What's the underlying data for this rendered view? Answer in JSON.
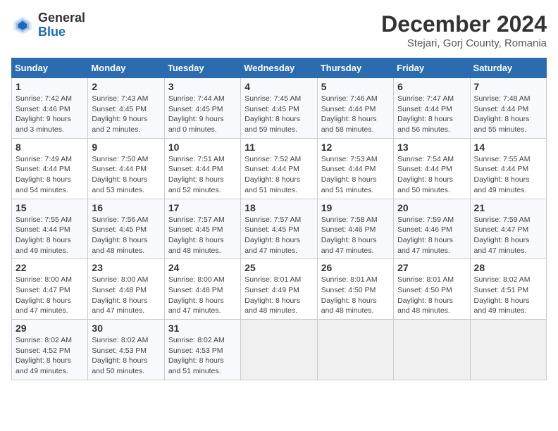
{
  "header": {
    "logo_general": "General",
    "logo_blue": "Blue",
    "title": "December 2024",
    "location": "Stejari, Gorj County, Romania"
  },
  "columns": [
    "Sunday",
    "Monday",
    "Tuesday",
    "Wednesday",
    "Thursday",
    "Friday",
    "Saturday"
  ],
  "weeks": [
    [
      {
        "day": "1",
        "info": "Sunrise: 7:42 AM\nSunset: 4:46 PM\nDaylight: 9 hours\nand 3 minutes."
      },
      {
        "day": "2",
        "info": "Sunrise: 7:43 AM\nSunset: 4:45 PM\nDaylight: 9 hours\nand 2 minutes."
      },
      {
        "day": "3",
        "info": "Sunrise: 7:44 AM\nSunset: 4:45 PM\nDaylight: 9 hours\nand 0 minutes."
      },
      {
        "day": "4",
        "info": "Sunrise: 7:45 AM\nSunset: 4:45 PM\nDaylight: 8 hours\nand 59 minutes."
      },
      {
        "day": "5",
        "info": "Sunrise: 7:46 AM\nSunset: 4:44 PM\nDaylight: 8 hours\nand 58 minutes."
      },
      {
        "day": "6",
        "info": "Sunrise: 7:47 AM\nSunset: 4:44 PM\nDaylight: 8 hours\nand 56 minutes."
      },
      {
        "day": "7",
        "info": "Sunrise: 7:48 AM\nSunset: 4:44 PM\nDaylight: 8 hours\nand 55 minutes."
      }
    ],
    [
      {
        "day": "8",
        "info": "Sunrise: 7:49 AM\nSunset: 4:44 PM\nDaylight: 8 hours\nand 54 minutes."
      },
      {
        "day": "9",
        "info": "Sunrise: 7:50 AM\nSunset: 4:44 PM\nDaylight: 8 hours\nand 53 minutes."
      },
      {
        "day": "10",
        "info": "Sunrise: 7:51 AM\nSunset: 4:44 PM\nDaylight: 8 hours\nand 52 minutes."
      },
      {
        "day": "11",
        "info": "Sunrise: 7:52 AM\nSunset: 4:44 PM\nDaylight: 8 hours\nand 51 minutes."
      },
      {
        "day": "12",
        "info": "Sunrise: 7:53 AM\nSunset: 4:44 PM\nDaylight: 8 hours\nand 51 minutes."
      },
      {
        "day": "13",
        "info": "Sunrise: 7:54 AM\nSunset: 4:44 PM\nDaylight: 8 hours\nand 50 minutes."
      },
      {
        "day": "14",
        "info": "Sunrise: 7:55 AM\nSunset: 4:44 PM\nDaylight: 8 hours\nand 49 minutes."
      }
    ],
    [
      {
        "day": "15",
        "info": "Sunrise: 7:55 AM\nSunset: 4:44 PM\nDaylight: 8 hours\nand 49 minutes."
      },
      {
        "day": "16",
        "info": "Sunrise: 7:56 AM\nSunset: 4:45 PM\nDaylight: 8 hours\nand 48 minutes."
      },
      {
        "day": "17",
        "info": "Sunrise: 7:57 AM\nSunset: 4:45 PM\nDaylight: 8 hours\nand 48 minutes."
      },
      {
        "day": "18",
        "info": "Sunrise: 7:57 AM\nSunset: 4:45 PM\nDaylight: 8 hours\nand 47 minutes."
      },
      {
        "day": "19",
        "info": "Sunrise: 7:58 AM\nSunset: 4:46 PM\nDaylight: 8 hours\nand 47 minutes."
      },
      {
        "day": "20",
        "info": "Sunrise: 7:59 AM\nSunset: 4:46 PM\nDaylight: 8 hours\nand 47 minutes."
      },
      {
        "day": "21",
        "info": "Sunrise: 7:59 AM\nSunset: 4:47 PM\nDaylight: 8 hours\nand 47 minutes."
      }
    ],
    [
      {
        "day": "22",
        "info": "Sunrise: 8:00 AM\nSunset: 4:47 PM\nDaylight: 8 hours\nand 47 minutes."
      },
      {
        "day": "23",
        "info": "Sunrise: 8:00 AM\nSunset: 4:48 PM\nDaylight: 8 hours\nand 47 minutes."
      },
      {
        "day": "24",
        "info": "Sunrise: 8:00 AM\nSunset: 4:48 PM\nDaylight: 8 hours\nand 47 minutes."
      },
      {
        "day": "25",
        "info": "Sunrise: 8:01 AM\nSunset: 4:49 PM\nDaylight: 8 hours\nand 48 minutes."
      },
      {
        "day": "26",
        "info": "Sunrise: 8:01 AM\nSunset: 4:50 PM\nDaylight: 8 hours\nand 48 minutes."
      },
      {
        "day": "27",
        "info": "Sunrise: 8:01 AM\nSunset: 4:50 PM\nDaylight: 8 hours\nand 48 minutes."
      },
      {
        "day": "28",
        "info": "Sunrise: 8:02 AM\nSunset: 4:51 PM\nDaylight: 8 hours\nand 49 minutes."
      }
    ],
    [
      {
        "day": "29",
        "info": "Sunrise: 8:02 AM\nSunset: 4:52 PM\nDaylight: 8 hours\nand 49 minutes."
      },
      {
        "day": "30",
        "info": "Sunrise: 8:02 AM\nSunset: 4:53 PM\nDaylight: 8 hours\nand 50 minutes."
      },
      {
        "day": "31",
        "info": "Sunrise: 8:02 AM\nSunset: 4:53 PM\nDaylight: 8 hours\nand 51 minutes."
      },
      {
        "day": "",
        "info": ""
      },
      {
        "day": "",
        "info": ""
      },
      {
        "day": "",
        "info": ""
      },
      {
        "day": "",
        "info": ""
      }
    ]
  ]
}
